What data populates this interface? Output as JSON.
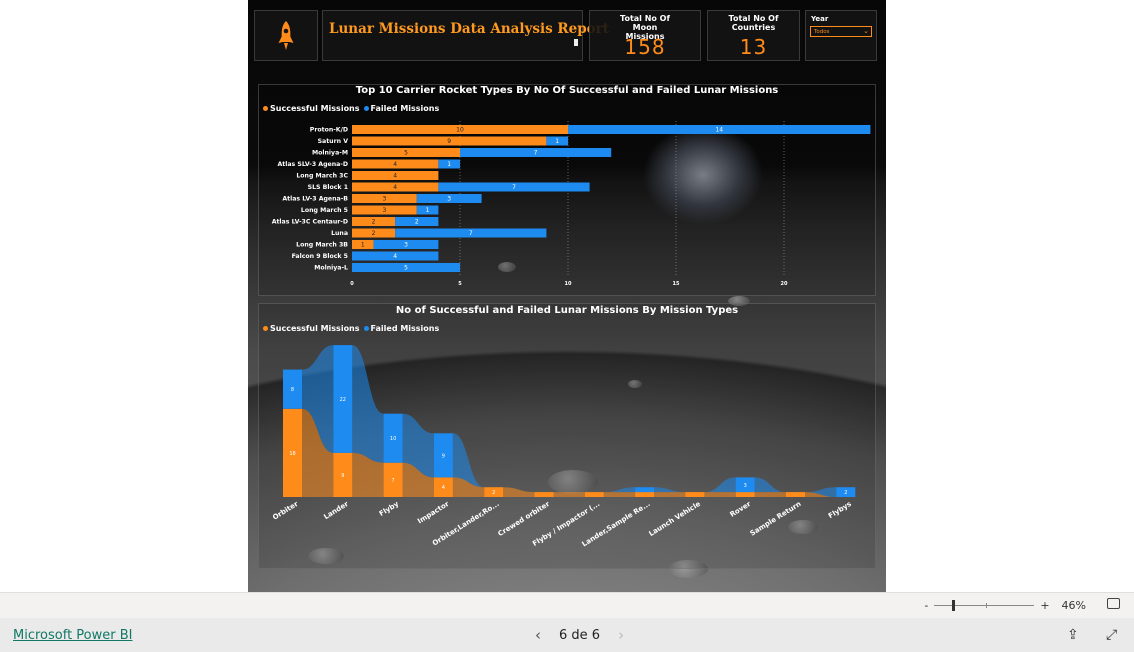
{
  "report": {
    "title": "Lunar Missions Data Analysis Report",
    "kpi_missions": {
      "label": "Total No Of Moon Missions",
      "value": "158"
    },
    "kpi_countries": {
      "label": "Total No Of Countries",
      "value": "13"
    },
    "year_filter": {
      "label": "Year",
      "selected": "Todos"
    }
  },
  "colors": {
    "successful": "#ff8c1a",
    "failed": "#1e8bf0",
    "title": "#ff9a1f"
  },
  "icons": {
    "logo": "rocket-icon"
  },
  "chart_data": [
    {
      "type": "bar",
      "title": "Top 10 Carrier Rocket Types By No Of Successful and Failed Lunar Missions",
      "orientation": "horizontal-stacked",
      "categories": [
        "Proton-K/D",
        "Saturn V",
        "Molniya-M",
        "Atlas SLV-3 Agena-D",
        "Long March 3C",
        "SLS Block 1",
        "Atlas LV-3 Agena-B",
        "Long March 5",
        "Atlas LV-3C Centaur-D",
        "Luna",
        "Long March 3B",
        "Falcon 9 Block 5",
        "Molniya-L"
      ],
      "series": [
        {
          "name": "Successful Missions",
          "values": [
            10,
            9,
            5,
            4,
            4,
            4,
            3,
            3,
            2,
            2,
            1,
            0,
            0
          ]
        },
        {
          "name": "Failed Missions",
          "values": [
            14,
            1,
            7,
            1,
            0,
            7,
            3,
            1,
            2,
            7,
            3,
            4,
            5
          ]
        }
      ],
      "xticks": [
        0,
        5,
        10,
        15,
        20
      ],
      "xlim": [
        0,
        24
      ],
      "legend": "top-left"
    },
    {
      "type": "area",
      "title": "No of Successful and Failed Lunar Missions By Mission Types",
      "categories": [
        "Orbiter",
        "Lander",
        "Flyby",
        "Impactor",
        "Orbiter,Lander,Ro...",
        "Crewed orbiter",
        "Flyby / Impactor (...",
        "Lander,Sample Re...",
        "Launch Vehicle",
        "Rover",
        "Sample Return",
        "Flybys"
      ],
      "series": [
        {
          "name": "Successful Missions",
          "values": [
            18,
            9,
            7,
            4,
            2,
            1,
            1,
            1,
            1,
            1,
            1,
            0
          ]
        },
        {
          "name": "Failed Missions",
          "values": [
            8,
            22,
            10,
            9,
            0,
            0,
            0,
            1,
            0,
            3,
            0,
            2
          ]
        }
      ],
      "legend": "top-left"
    }
  ],
  "status_bar": {
    "zoom_minus": "-",
    "zoom_plus": "+",
    "zoom": "46%"
  },
  "footer": {
    "brand": "Microsoft Power BI",
    "page_indicator": "6 de 6"
  }
}
